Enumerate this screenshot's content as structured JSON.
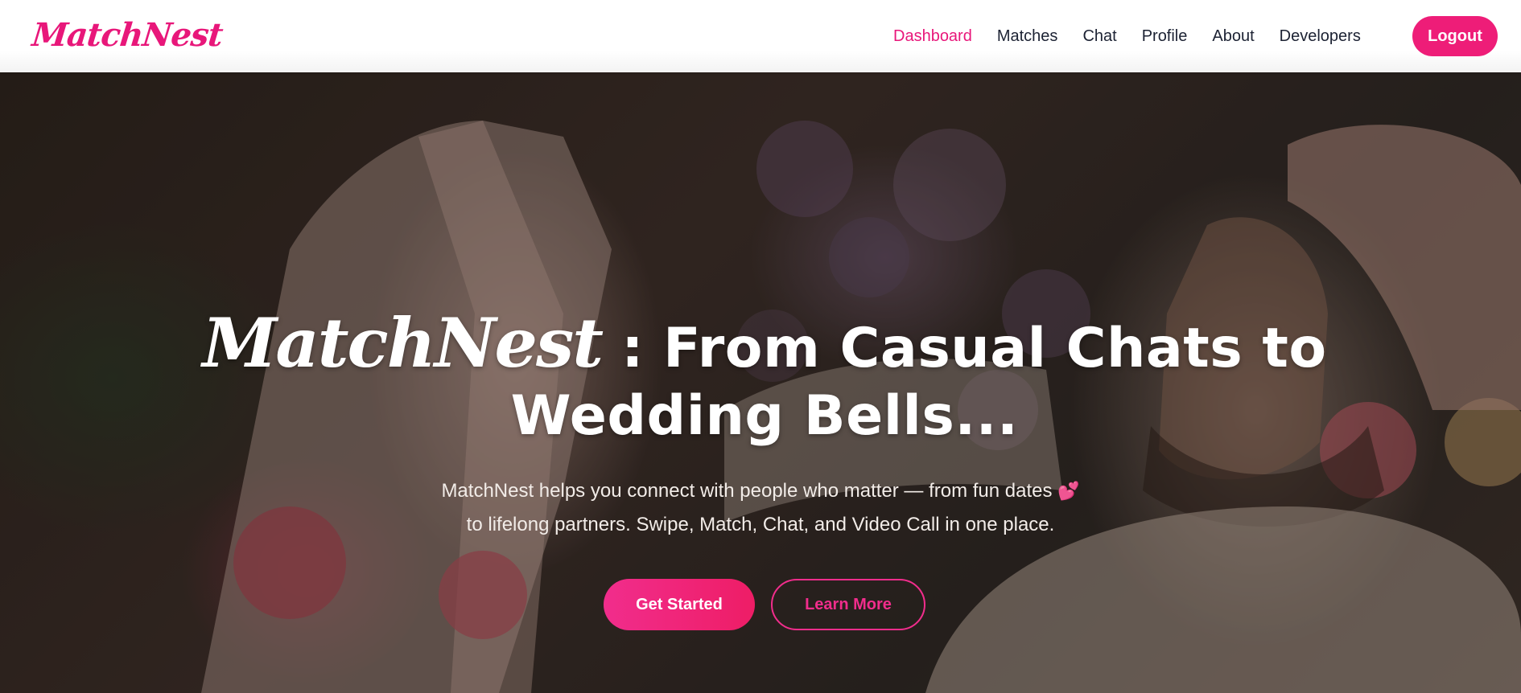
{
  "navbar": {
    "brand": "MatchNest",
    "links": [
      {
        "label": "Dashboard",
        "active": true
      },
      {
        "label": "Matches",
        "active": false
      },
      {
        "label": "Chat",
        "active": false
      },
      {
        "label": "Profile",
        "active": false
      },
      {
        "label": "About",
        "active": false
      },
      {
        "label": "Developers",
        "active": false
      }
    ],
    "logout_label": "Logout"
  },
  "hero": {
    "title_brand": "MatchNest",
    "title_separator": " : ",
    "title_rest": "From Casual Chats to Wedding Bells...",
    "subtitle_line1": "MatchNest helps you connect with people who matter — from fun dates",
    "subtitle_heart": "💕",
    "subtitle_line2": "to lifelong partners. Swipe, Match, Chat, and Video Call in one place.",
    "primary_cta": "Get Started",
    "secondary_cta": "Learn More",
    "background_image": "wedding-couple-photo"
  },
  "colors": {
    "brand_pink": "#e8177a",
    "nav_text": "#1c2233",
    "button_pink": "#ee1d78"
  }
}
